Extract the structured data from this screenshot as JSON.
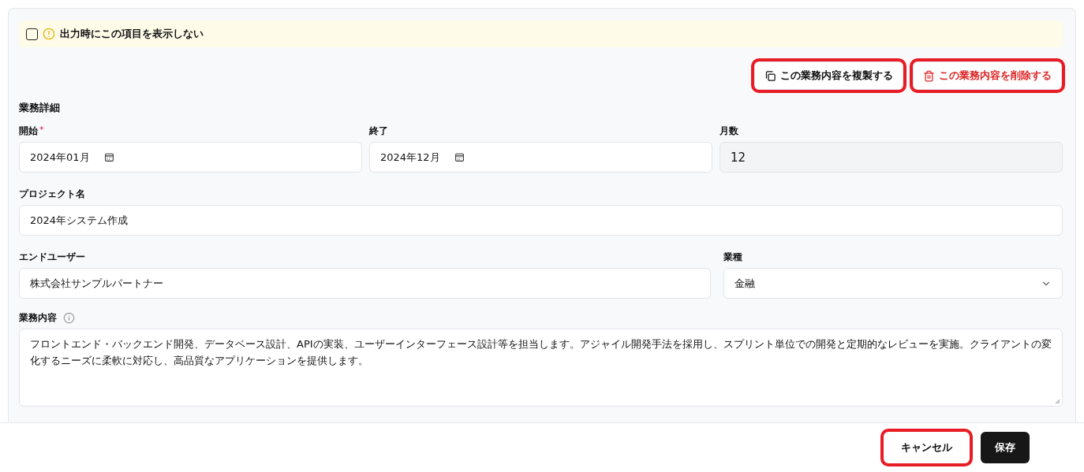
{
  "notice": {
    "checked": false,
    "label": "出力時にこの項目を表示しない"
  },
  "actions": [
    {
      "kind": "duplicate",
      "label": "この業務内容を複製する",
      "highlighted": true
    },
    {
      "kind": "delete",
      "label": "この業務内容を削除する",
      "highlighted": true
    }
  ],
  "section_title": "業務詳細",
  "period": [
    {
      "label": "開始",
      "required_mark": "*",
      "value": "2024年01月",
      "kind": "month"
    },
    {
      "label": "終了",
      "value": "2024年12月",
      "kind": "month"
    },
    {
      "label": "月数",
      "value": "12",
      "kind": "readonly"
    }
  ],
  "project_name": {
    "label": "プロジェクト名",
    "value": "2024年システム作成"
  },
  "end_user": {
    "label": "エンドユーザー",
    "value": "株式会社サンプルパートナー"
  },
  "industry": {
    "label": "業種",
    "value": "金融"
  },
  "description": {
    "label": "業務内容",
    "value": "フロントエンド・バックエンド開発、データベース設計、APIの実装、ユーザーインターフェース設計等を担当します。アジャイル開発手法を採用し、スプリント単位での開発と定期的なレビューを実施。クライアントの変化するニーズに柔軟に対応し、高品質なアプリケーションを提供します。"
  },
  "footer_buttons": [
    {
      "kind": "secondary",
      "label": "キャンセル",
      "highlighted": true
    },
    {
      "kind": "primary",
      "label": "保存",
      "highlighted": false
    }
  ]
}
